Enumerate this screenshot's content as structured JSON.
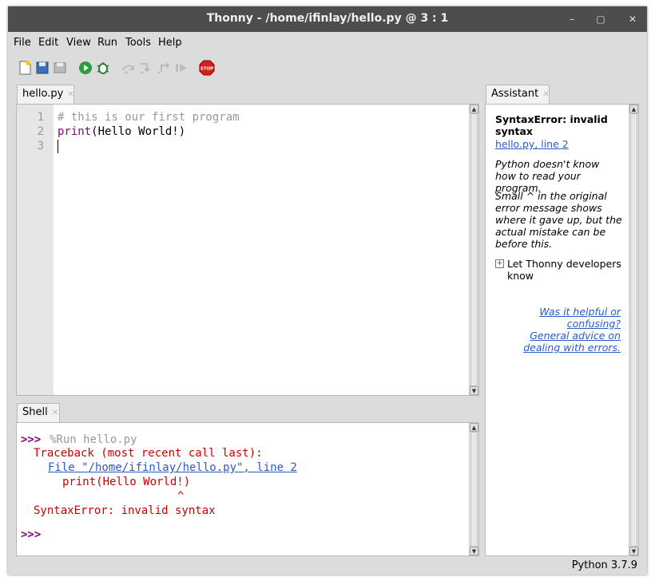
{
  "window": {
    "title": "Thonny  -  /home/ifinlay/hello.py  @  3 : 1"
  },
  "menu": [
    "File",
    "Edit",
    "View",
    "Run",
    "Tools",
    "Help"
  ],
  "toolbar_icons": [
    "new-file-icon",
    "open-file-icon",
    "save-file-icon",
    "run-icon",
    "debug-icon",
    "step-over-icon",
    "step-into-icon",
    "step-out-icon",
    "resume-icon",
    "stop-icon"
  ],
  "stop_label": "STOP",
  "editor": {
    "tab": "hello.py",
    "lines": [
      {
        "n": "1",
        "text": "# this is our first program"
      },
      {
        "n": "2",
        "text_fn": "print",
        "text_rest": "(Hello World!)"
      },
      {
        "n": "3",
        "text": ""
      }
    ]
  },
  "shell": {
    "tab": "Shell",
    "prompt": ">>>",
    "run_cmd": "%Run hello.py",
    "traceback": "Traceback (most recent call last):",
    "file_link": "File \"/home/ifinlay/hello.py\", line 2",
    "code_line": "print(Hello World!)",
    "caret": "^",
    "error": "SyntaxError: invalid syntax",
    "prompt2": ">>>"
  },
  "assistant": {
    "tab": "Assistant",
    "heading": "SyntaxError: invalid syntax",
    "location_link": "hello.py, line 2",
    "para1": "Python doesn't know how to read your program.",
    "para2": "Small ^ in the original error message shows where it gave up, but the actual mistake can be before this.",
    "expander": "Let Thonny developers know",
    "helpful_link": "Was it helpful or confusing?",
    "advice_link": "General advice on dealing with errors."
  },
  "status": {
    "python_version": "Python 3.7.9"
  },
  "colors": {
    "comment": "#999999",
    "builtin": "#8b008b",
    "error": "#cc0000",
    "link": "#2a59c8",
    "prompt": "#8b008b"
  }
}
